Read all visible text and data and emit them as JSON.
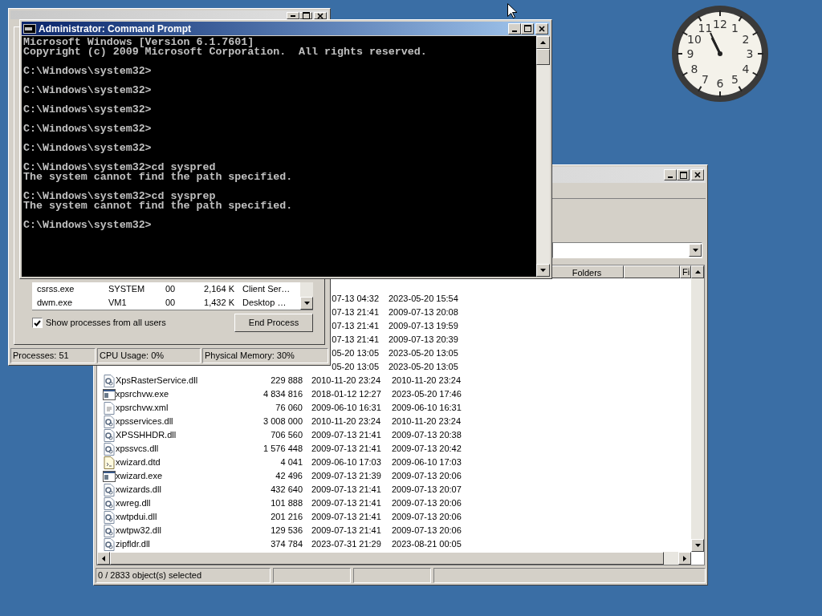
{
  "task_manager": {
    "processes": [
      {
        "name": "csrss.exe",
        "user": "SYSTEM",
        "cpu": "00",
        "memory": "2,164 K",
        "description": "Client Ser…"
      },
      {
        "name": "dwm.exe",
        "user": "VM1",
        "cpu": "00",
        "memory": "1,432 K",
        "description": "Desktop …"
      }
    ],
    "show_all_users": {
      "label": "Show processes from all users",
      "checked": true
    },
    "end_process_button": "End Process",
    "status_bar": [
      "Processes: 51",
      "CPU Usage: 0%",
      "Physical Memory: 30%"
    ]
  },
  "command_prompt": {
    "title": "Administrator: Command Prompt",
    "blocks": [
      [
        "Microsoft Windows [Version 6.1.7601]",
        "Copyright (c) 2009 Microsoft Corporation.  All rights reserved."
      ],
      [
        "C:\\Windows\\system32>"
      ],
      [
        "C:\\Windows\\system32>"
      ],
      [
        "C:\\Windows\\system32>"
      ],
      [
        "C:\\Windows\\system32>"
      ],
      [
        "C:\\Windows\\system32>"
      ],
      [
        "C:\\Windows\\system32>cd syspred",
        "The system cannot find the path specified."
      ],
      [
        "C:\\Windows\\system32>cd sysprep",
        "The system cannot find the path specified."
      ],
      [
        "C:\\Windows\\system32>"
      ]
    ]
  },
  "explorer": {
    "columns": [
      "Folders",
      "Fi"
    ],
    "partial_rows": [
      {
        "created": "07-13 04:32",
        "modified": "2023-05-20 15:54"
      },
      {
        "created": "07-13 21:41",
        "modified": "2009-07-13 20:08"
      },
      {
        "created": "07-13 21:41",
        "modified": "2009-07-13 19:59"
      },
      {
        "created": "07-13 21:41",
        "modified": "2009-07-13 20:39"
      },
      {
        "created": "05-20 13:05",
        "modified": "2023-05-20 13:05"
      },
      {
        "created": "05-20 13:05",
        "modified": "2023-05-20 13:05"
      }
    ],
    "rows": [
      {
        "kind": "dll",
        "name": "XpsRasterService.dll",
        "size": "229 888",
        "created": "2010-11-20 23:24",
        "modified": "2010-11-20 23:24"
      },
      {
        "kind": "exe",
        "name": "xpsrchvw.exe",
        "size": "4 834 816",
        "created": "2018-01-12 12:27",
        "modified": "2023-05-20 17:46"
      },
      {
        "kind": "xml",
        "name": "xpsrchvw.xml",
        "size": "76 060",
        "created": "2009-06-10 16:31",
        "modified": "2009-06-10 16:31"
      },
      {
        "kind": "dll",
        "name": "xpsservices.dll",
        "size": "3 008 000",
        "created": "2010-11-20 23:24",
        "modified": "2010-11-20 23:24"
      },
      {
        "kind": "dll",
        "name": "XPSSHHDR.dll",
        "size": "706 560",
        "created": "2009-07-13 21:41",
        "modified": "2009-07-13 20:38"
      },
      {
        "kind": "dll",
        "name": "xpssvcs.dll",
        "size": "1 576 448",
        "created": "2009-07-13 21:41",
        "modified": "2009-07-13 20:42"
      },
      {
        "kind": "dtd",
        "name": "xwizard.dtd",
        "size": "4 041",
        "created": "2009-06-10 17:03",
        "modified": "2009-06-10 17:03"
      },
      {
        "kind": "exe",
        "name": "xwizard.exe",
        "size": "42 496",
        "created": "2009-07-13 21:39",
        "modified": "2009-07-13 20:06"
      },
      {
        "kind": "dll",
        "name": "xwizards.dll",
        "size": "432 640",
        "created": "2009-07-13 21:41",
        "modified": "2009-07-13 20:07"
      },
      {
        "kind": "dll",
        "name": "xwreg.dll",
        "size": "101 888",
        "created": "2009-07-13 21:41",
        "modified": "2009-07-13 20:06"
      },
      {
        "kind": "dll",
        "name": "xwtpdui.dll",
        "size": "201 216",
        "created": "2009-07-13 21:41",
        "modified": "2009-07-13 20:06"
      },
      {
        "kind": "dll",
        "name": "xwtpw32.dll",
        "size": "129 536",
        "created": "2009-07-13 21:41",
        "modified": "2009-07-13 20:06"
      },
      {
        "kind": "dll",
        "name": "zipfldr.dll",
        "size": "374 784",
        "created": "2023-07-31 21:29",
        "modified": "2023-08-21 00:05"
      }
    ],
    "status_bar": [
      "0 / 2833 object(s) selected"
    ]
  },
  "clock": {
    "numerals": [
      "11",
      "12",
      "1",
      "10",
      "2",
      "9",
      "3",
      "8",
      "4",
      "7",
      "6",
      "5"
    ]
  }
}
